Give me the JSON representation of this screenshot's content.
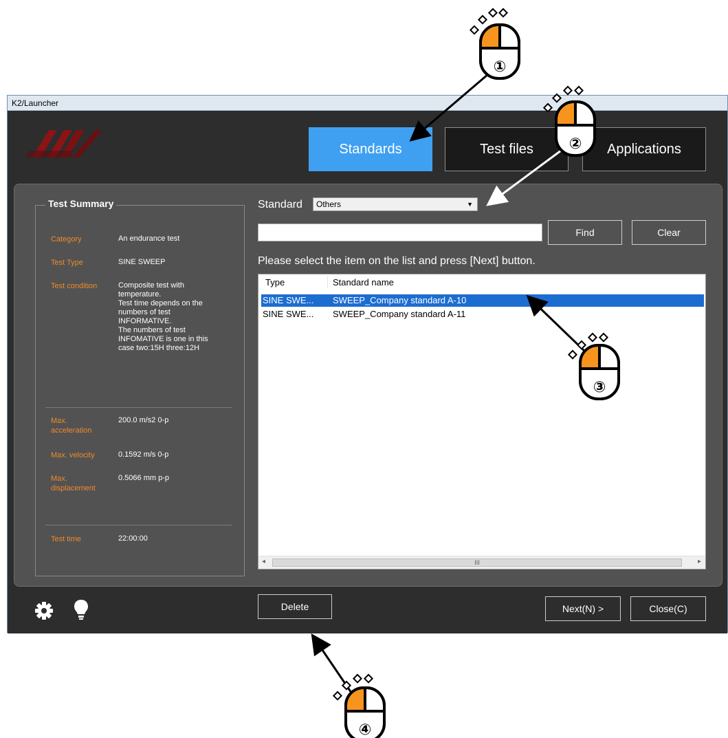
{
  "window": {
    "title": "K2/Launcher"
  },
  "tabs": [
    {
      "label": "Standards",
      "active": true
    },
    {
      "label": "Test files",
      "active": false
    },
    {
      "label": "Applications",
      "active": false
    }
  ],
  "summary": {
    "title": "Test Summary",
    "fields": [
      {
        "label": "Category",
        "value": "An endurance test"
      },
      {
        "label": "Test Type",
        "value": "SINE SWEEP"
      },
      {
        "label": "Test condition",
        "value_lines": [
          "Composite test with",
          "temperature.",
          "Test time depends on the",
          "numbers of test",
          "INFORMATIVE.",
          "The numbers of test",
          "INFOMATIVE is one in this",
          "case two:15H three:12H"
        ]
      },
      {
        "label_lines": [
          "Max.",
          "acceleration"
        ],
        "value": "200.0 m/s2 0-p"
      },
      {
        "label": "Max. velocity",
        "value": "0.1592 m/s 0-p"
      },
      {
        "label_lines": [
          "Max.",
          "displacement"
        ],
        "value": "0.5066 mm p-p"
      },
      {
        "label": "Test time",
        "value": "22:00:00"
      }
    ]
  },
  "standard": {
    "label": "Standard",
    "selected": "Others"
  },
  "search": {
    "value": "",
    "find_label": "Find",
    "clear_label": "Clear"
  },
  "instruction": "Please select the item on the list and press [Next] button.",
  "list": {
    "columns": [
      "Type",
      "Standard name"
    ],
    "rows": [
      {
        "type": "SINE SWE...",
        "name": "SWEEP_Company standard  A-10",
        "selected": true
      },
      {
        "type": "SINE SWE...",
        "name": "SWEEP_Company standard  A-11",
        "selected": false
      }
    ],
    "scroll_thumb_glyph": "III"
  },
  "footer": {
    "delete_label": "Delete",
    "next_label": "Next(N) >",
    "close_label": "Close(C)",
    "icons": [
      "gear-icon",
      "lightbulb-icon"
    ]
  },
  "annotations": [
    "①",
    "②",
    "③",
    "④"
  ],
  "colors": {
    "accent": "#3fa0f1",
    "selection": "#1c6dd0",
    "label_orange": "#f08a2a",
    "mouse_orange": "#f7941d"
  }
}
